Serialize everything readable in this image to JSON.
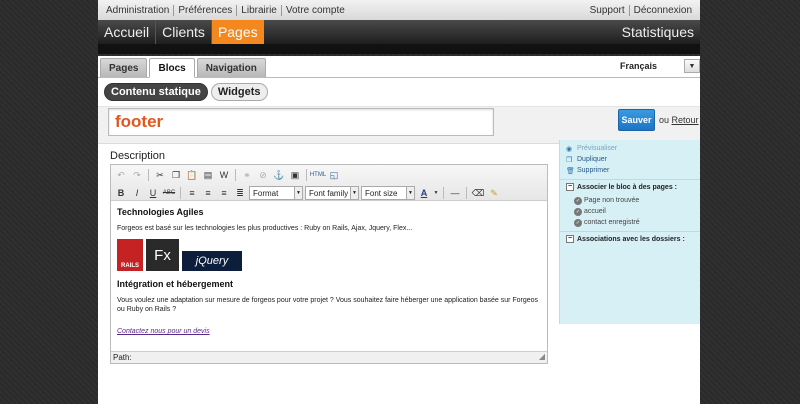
{
  "topbar": {
    "left": [
      "Administration",
      "Préférences",
      "Librairie",
      "Votre compte"
    ],
    "right": [
      "Support",
      "Déconnexion"
    ]
  },
  "navbar": {
    "items": [
      "Accueil",
      "Clients",
      "Pages"
    ],
    "active_index": 2,
    "right": "Statistiques"
  },
  "tabs": [
    "Pages",
    "Blocs",
    "Navigation"
  ],
  "active_tab": "Blocs",
  "language": {
    "selected": "Français"
  },
  "subtabs": [
    "Contenu statique",
    "Widgets"
  ],
  "block": {
    "title": "footer",
    "save_label": "Sauver",
    "or_label": "ou",
    "back_label": "Retour"
  },
  "editor": {
    "description_label": "Description",
    "format_label": "Format",
    "font_family_label": "Font family",
    "font_size_label": "Font size",
    "heading1": "Technologies Agiles",
    "para1": "Forgeos est basé sur les technologies les plus productives : Ruby on Rails, Ajax, Jquery, Flex...",
    "heading2": "Intégration et hébergement",
    "para2": "Vous voulez une adaptation sur mesure de forgeos pour votre projet ? Vous souhaitez faire héberger une application basée sur Forgeos ou Ruby on Rails ?",
    "link": "Contactez nous pour un devis",
    "path_label": "Path:",
    "logos": {
      "rails": "RAILS",
      "fx": "Fx",
      "jquery": "jQuery"
    }
  },
  "sidebar": {
    "links": [
      "Prévisualiser",
      "Dupliquer",
      "Supprimer"
    ],
    "assoc_pages_title": "Associer le bloc à des pages :",
    "pages": [
      "Page non trouvée",
      "accueil",
      "contact enregistré"
    ],
    "assoc_folders_title": "Associations avec les dossiers :"
  },
  "colors": {
    "accent": "#f5871f",
    "save_button": "#2a86d4",
    "sidebar_bg": "#d6f0f5",
    "title_text": "#e3561e"
  }
}
